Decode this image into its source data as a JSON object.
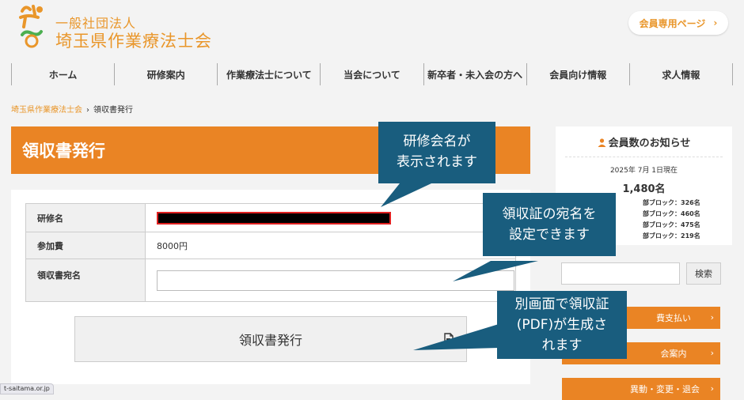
{
  "header": {
    "org_type": "一般社団法人",
    "org_name": "埼玉県作業療法士会",
    "member_page_label": "会員専用ページ",
    "member_page_chevron": "›"
  },
  "nav": [
    {
      "label": "ホーム"
    },
    {
      "label": "研修案内"
    },
    {
      "label": "作業療法士について"
    },
    {
      "label": "当会について"
    },
    {
      "label": "新卒者・未入会の方へ"
    },
    {
      "label": "会員向け情報"
    },
    {
      "label": "求人情報"
    }
  ],
  "breadcrumb": {
    "home": "埼玉県作業療法士会",
    "sep": "›",
    "current": "領収書発行"
  },
  "page_title": "領収書発行",
  "form": {
    "rows": [
      {
        "label": "研修名",
        "value": ""
      },
      {
        "label": "参加費",
        "value": "8000円"
      },
      {
        "label": "領収書宛名",
        "value": ""
      }
    ],
    "submit_label": "領収書発行"
  },
  "sidebar": {
    "notice_title": "会員数のお知らせ",
    "date": "2025年 7月 1日現在",
    "total": "1,480名",
    "blocks": [
      "部ブロック：326名",
      "部ブロック：460名",
      "部ブロック：475名",
      "部ブロック：219名"
    ],
    "search_button": "検索",
    "links": [
      "費支払い",
      "会案内",
      "異動・変更・退会"
    ],
    "link_chevron": "›"
  },
  "callouts": [
    {
      "line1": "研修会名が",
      "line2": "表示されます",
      "line3": ""
    },
    {
      "line1": "領収証の宛名を",
      "line2": "設定できます",
      "line3": ""
    },
    {
      "line1": "別画面で領収証",
      "line2": "(PDF)が生成さ",
      "line3": "れます"
    }
  ],
  "status_url": "t-saitama.or.jp",
  "colors": {
    "accent": "#ea8424",
    "logo": "#e9962a",
    "callout": "#195d7e",
    "redact_border": "#e02020"
  },
  "icons": [
    "logo-mark",
    "person-icon",
    "chevron-right-icon",
    "pdf-file-icon"
  ]
}
